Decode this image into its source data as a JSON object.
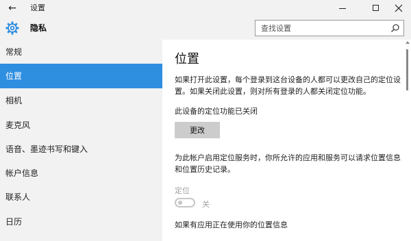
{
  "titlebar": {
    "title": "设置"
  },
  "header": {
    "title": "隐私"
  },
  "search": {
    "placeholder": "查找设置"
  },
  "sidebar": {
    "items": [
      {
        "label": "常规"
      },
      {
        "label": "位置"
      },
      {
        "label": "相机"
      },
      {
        "label": "麦克风"
      },
      {
        "label": "语音、墨迹书写和键入"
      },
      {
        "label": "帐户信息"
      },
      {
        "label": "联系人"
      },
      {
        "label": "日历"
      }
    ],
    "active_index": 1
  },
  "main": {
    "heading": "位置",
    "intro": "如果打开此设置，每个登录到这台设备的人都可以更改自己的定位设置。如果关闭此设置，则对所有登录的人都关闭定位功能。",
    "device_status": "此设备的定位功能已关闭",
    "change_button": "更改",
    "service_text": "为此帐户启用定位服务时，你所允许的应用和服务可以请求位置信息和位置历史记录。",
    "location_label": "定位",
    "toggle_state": "关",
    "toggle_on": false,
    "footer_text": "如果有应用正在使用你的位置信息"
  },
  "colors": {
    "accent": "#2e8ee0",
    "chrome": "#f2f2f2",
    "button": "#cccccc",
    "disabled_text": "#a0a0a0"
  },
  "icons": {
    "back": "back-arrow-icon",
    "settings": "gear-icon",
    "search": "search-icon",
    "minimize": "minimize-icon",
    "maximize": "maximize-icon",
    "close": "close-icon"
  }
}
